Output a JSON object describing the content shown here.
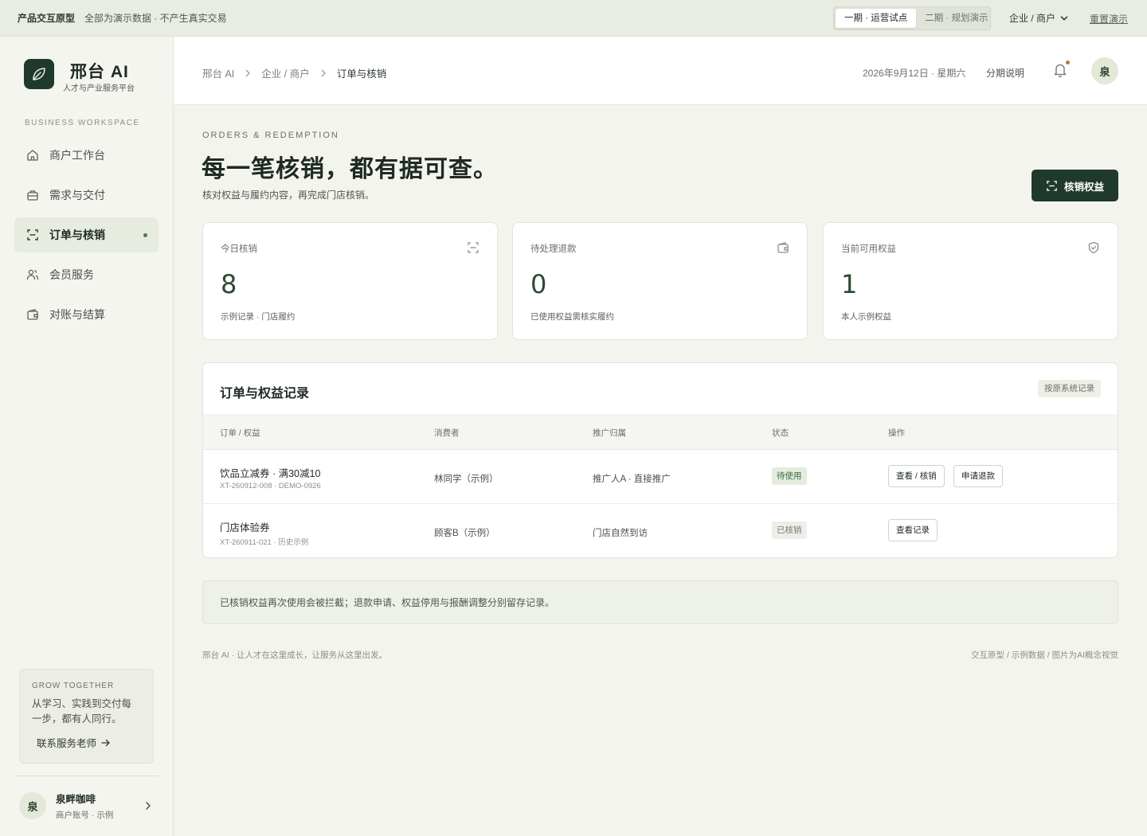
{
  "topbar": {
    "proto_label": "产品交互原型",
    "note": "全部为演示数据 · 不产生真实交易",
    "phases": [
      {
        "label": "一期 · 运营试点",
        "active": true
      },
      {
        "label": "二期 · 规划演示",
        "active": false
      }
    ],
    "role_label": "企业 / 商户",
    "reset_label": "重置演示"
  },
  "sidebar": {
    "brand_name": "邢台 AI",
    "brand_sub": "人才与产业服务平台",
    "workspace_label": "BUSINESS WORKSPACE",
    "items": [
      {
        "label": "商户工作台",
        "icon": "home-icon",
        "active": false
      },
      {
        "label": "需求与交付",
        "icon": "briefcase-icon",
        "active": false
      },
      {
        "label": "订单与核销",
        "icon": "scan-icon",
        "active": true
      },
      {
        "label": "会员服务",
        "icon": "users-icon",
        "active": false
      },
      {
        "label": "对账与结算",
        "icon": "wallet-icon",
        "active": false
      }
    ],
    "promo": {
      "kicker": "GROW TOGETHER",
      "text": "从学习、实践到交付每一步，都有人同行。",
      "link": "联系服务老师"
    },
    "account": {
      "avatar": "泉",
      "name": "泉畔咖啡",
      "sub": "商户账号 · 示例"
    }
  },
  "header": {
    "breadcrumbs": [
      "邢台 AI",
      "企业 / 商户",
      "订单与核销"
    ],
    "date": "2026年9月12日 · 星期六",
    "phase_note": "分期说明",
    "avatar": "泉"
  },
  "main": {
    "eyebrow": "ORDERS & REDEMPTION",
    "headline": "每一笔核销，都有据可查。",
    "subline": "核对权益与履约内容，再完成门店核销。",
    "primary_button": "核销权益",
    "stats": [
      {
        "label": "今日核销",
        "value": "8",
        "desc": "示例记录 · 门店履约",
        "icon": "scan-icon"
      },
      {
        "label": "待处理退款",
        "value": "0",
        "desc": "已使用权益需核实履约",
        "icon": "wallet-icon"
      },
      {
        "label": "当前可用权益",
        "value": "1",
        "desc": "本人示例权益",
        "icon": "shield-check-icon"
      }
    ],
    "table": {
      "title": "订单与权益记录",
      "tag": "按原系统记录",
      "columns": [
        "订单 / 权益",
        "消费者",
        "推广归属",
        "状态",
        "操作"
      ],
      "rows": [
        {
          "name": "饮品立减券 · 满30减10",
          "code": "XT-260912-008 · DEMO-0926",
          "consumer": "林同学（示例）",
          "attribution": "推广人A · 直接推广",
          "status": "待使用",
          "actions": [
            "查看 / 核销",
            "申请退款"
          ]
        },
        {
          "name": "门店体验券",
          "code": "XT-260911-021 · 历史示例",
          "consumer": "顾客B（示例）",
          "attribution": "门店自然到访",
          "status": "已核销",
          "actions": [
            "查看记录"
          ]
        }
      ]
    },
    "notice": "已核销权益再次使用会被拦截；退款申请、权益停用与报酬调整分别留存记录。"
  },
  "footer": {
    "left": "邢台 AI · 让人才在这里成长，让服务从这里出发。",
    "right": "交互原型 / 示例数据 / 图片为AI概念视觉"
  },
  "colors": {
    "brand": "#1f3a2c",
    "accent": "#4f7a52",
    "background": "#f4f4ee",
    "status_pending": "#3d6b40",
    "notification_dot": "#b07a4a"
  }
}
